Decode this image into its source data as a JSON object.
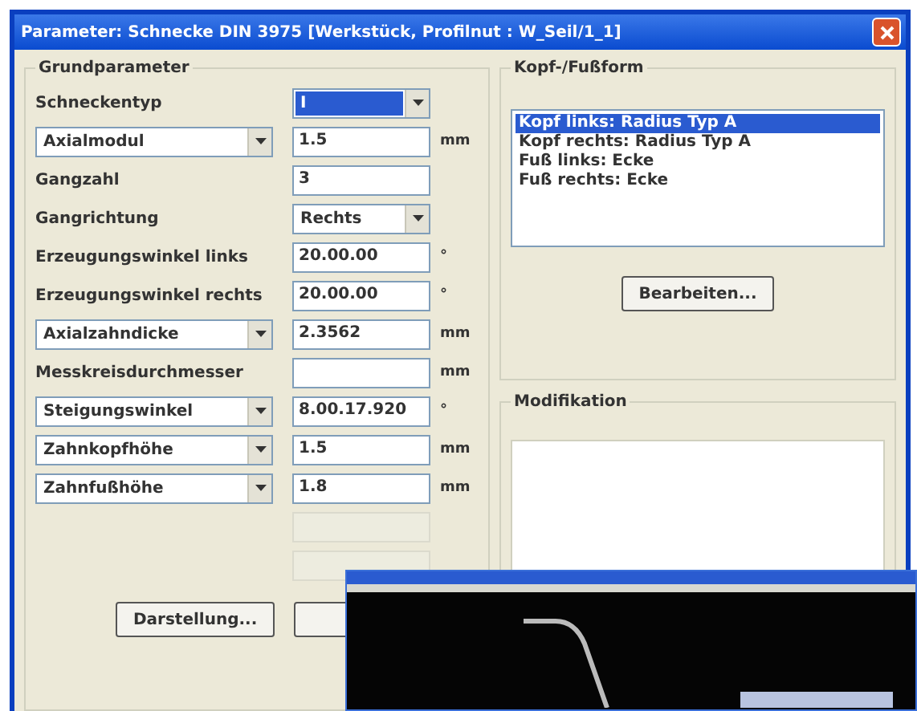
{
  "window": {
    "title": "Parameter: Schnecke DIN 3975 [Werkstück, Profilnut : W_Seil/1_1]"
  },
  "grundparameter": {
    "title": "Grundparameter",
    "rows": [
      {
        "kind": "select",
        "label": "Schneckentyp",
        "value": "I",
        "highlighted": true,
        "disabled": false
      },
      {
        "kind": "choice",
        "label": "Axialmodul",
        "value": "1.5",
        "unit": "mm",
        "disabled": false
      },
      {
        "kind": "plain",
        "label": "Gangzahl",
        "value": "3",
        "disabled": false
      },
      {
        "kind": "select",
        "label": "Gangrichtung",
        "value": "Rechts",
        "highlighted": false,
        "disabled": false
      },
      {
        "kind": "plain",
        "label": "Erzeugungswinkel links",
        "value": "20.00.00",
        "unit": "°",
        "disabled": false
      },
      {
        "kind": "plain",
        "label": "Erzeugungswinkel rechts",
        "value": "20.00.00",
        "unit": "°",
        "disabled": false
      },
      {
        "kind": "choice",
        "label": "Axialzahndicke",
        "value": "2.3562",
        "unit": "mm",
        "disabled": false
      },
      {
        "kind": "plain",
        "label": "Messkreisdurchmesser",
        "unit": "mm",
        "disabled": false
      },
      {
        "kind": "choice",
        "label": "Steigungswinkel",
        "value": "8.00.17.920",
        "unit": "°",
        "disabled": false
      },
      {
        "kind": "choice",
        "label": "Zahnkopfhöhe",
        "value": "1.5",
        "unit": "mm",
        "disabled": false
      },
      {
        "kind": "choice",
        "label": "Zahnfußhöhe",
        "value": "1.8",
        "unit": "mm",
        "disabled": false
      },
      {
        "kind": "plain",
        "disabled": true
      },
      {
        "kind": "plain",
        "disabled": true
      }
    ]
  },
  "kopf_fussform": {
    "title": "Kopf-/Fußform",
    "items": [
      {
        "label": "Kopf links: Radius Typ A",
        "selected": true
      },
      {
        "label": "Kopf rechts: Radius Typ A",
        "selected": false
      },
      {
        "label": "Fuß links: Ecke",
        "selected": false
      },
      {
        "label": "Fuß rechts: Ecke",
        "selected": false
      }
    ],
    "button": "Bearbeiten..."
  },
  "modifikation": {
    "title": "Modifikation"
  },
  "buttons": [
    "Darstellung..."
  ]
}
